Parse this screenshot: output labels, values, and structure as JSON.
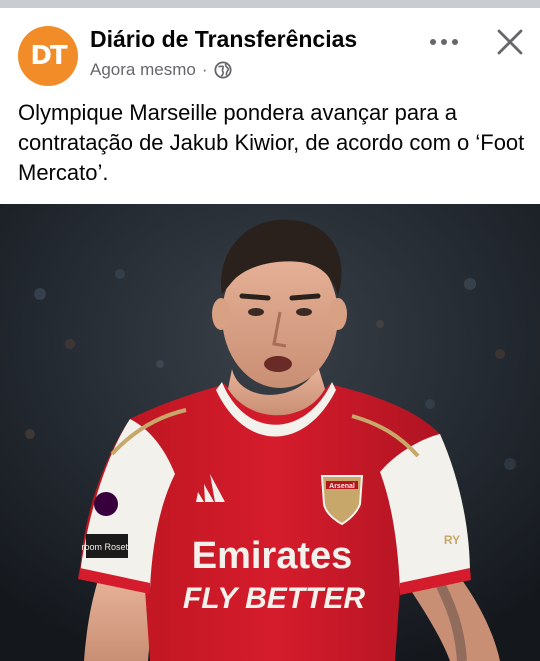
{
  "post": {
    "author": "Diário de Transferências",
    "avatar_initials": "DT",
    "timestamp": "Agora mesmo",
    "separator": "·",
    "visibility_icon": "globe-icon",
    "more_icon": "more-options-icon",
    "close_icon": "close-icon",
    "caption": "Olympique Marseille pondera avançar para a contratação de Jakub Kiwior, de acordo com o ‘Foot Mercato’."
  },
  "photo": {
    "shirt_sponsor_line1": "Emirates",
    "shirt_sponsor_line2": "FLY BETTER",
    "sleeve_patch": "room Rosetti",
    "badge_text": "Arsenal",
    "sleeve_right_text": "RY"
  },
  "colors": {
    "brand_avatar": "#f28c28",
    "text_primary": "#050505",
    "text_secondary": "#65676b",
    "kit_red": "#d51c2c"
  }
}
